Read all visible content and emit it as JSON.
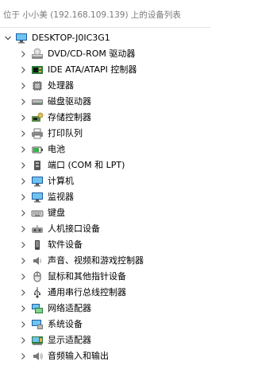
{
  "header": {
    "title": "位于 小小美 (192.168.109.139) 上的设备列表"
  },
  "tree": {
    "root": {
      "label": "DESKTOP-J0IC3G1",
      "icon": "computer-icon",
      "expanded": true
    },
    "items": [
      {
        "label": "DVD/CD-ROM 驱动器",
        "icon": "dvd-drive-icon"
      },
      {
        "label": "IDE ATA/ATAPI 控制器",
        "icon": "ide-controller-icon"
      },
      {
        "label": "处理器",
        "icon": "processor-icon"
      },
      {
        "label": "磁盘驱动器",
        "icon": "disk-drive-icon"
      },
      {
        "label": "存储控制器",
        "icon": "storage-controller-icon"
      },
      {
        "label": "打印队列",
        "icon": "printer-icon"
      },
      {
        "label": "电池",
        "icon": "battery-icon"
      },
      {
        "label": "端口 (COM 和 LPT)",
        "icon": "port-icon"
      },
      {
        "label": "计算机",
        "icon": "monitor-icon"
      },
      {
        "label": "监视器",
        "icon": "monitor-icon"
      },
      {
        "label": "键盘",
        "icon": "keyboard-icon"
      },
      {
        "label": "人机接口设备",
        "icon": "hid-icon"
      },
      {
        "label": "软件设备",
        "icon": "software-device-icon"
      },
      {
        "label": "声音、视频和游戏控制器",
        "icon": "speaker-icon"
      },
      {
        "label": "鼠标和其他指针设备",
        "icon": "mouse-icon"
      },
      {
        "label": "通用串行总线控制器",
        "icon": "usb-icon"
      },
      {
        "label": "网络适配器",
        "icon": "network-adapter-icon"
      },
      {
        "label": "系统设备",
        "icon": "system-device-icon"
      },
      {
        "label": "显示适配器",
        "icon": "display-adapter-icon"
      },
      {
        "label": "音频输入和输出",
        "icon": "audio-io-icon"
      }
    ]
  }
}
